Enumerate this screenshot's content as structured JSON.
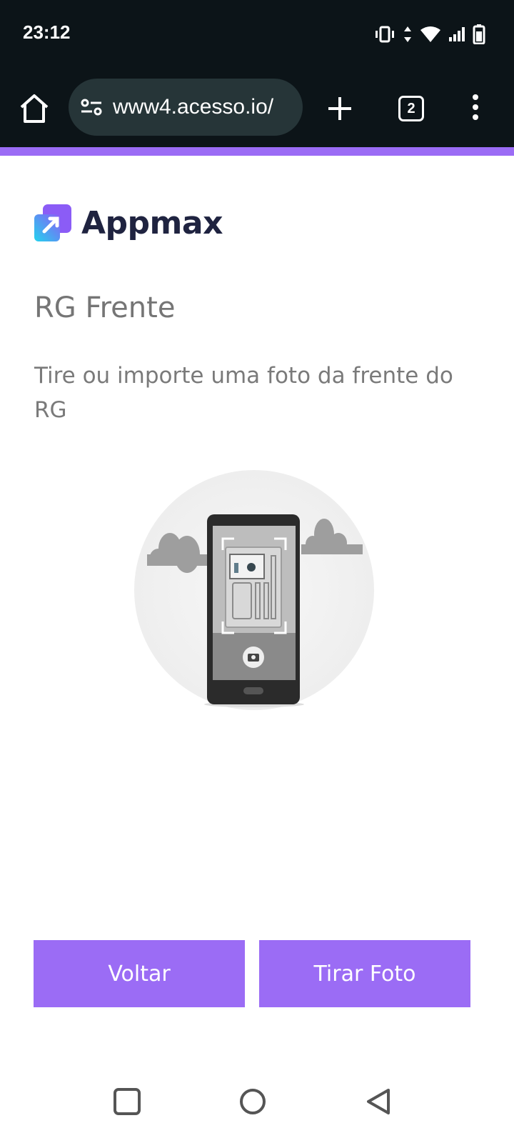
{
  "status_bar": {
    "time": "23:12",
    "icons": [
      "vibrate-icon",
      "data-arrows-icon",
      "wifi-icon",
      "signal-icon",
      "battery-icon"
    ]
  },
  "browser": {
    "url": "www4.acesso.io/",
    "tab_count": "2",
    "icons": [
      "home-icon",
      "site-settings-icon",
      "new-tab-icon",
      "tab-switcher-icon",
      "more-vert-icon"
    ]
  },
  "logo": {
    "text": "Appmax"
  },
  "page": {
    "title": "RG Frente",
    "subtitle": "Tire ou importe uma foto da frente do RG"
  },
  "illustration": {
    "name": "phone-camera-id-illustration"
  },
  "buttons": {
    "back_label": "Voltar",
    "take_photo_label": "Tirar Foto"
  },
  "nav": {
    "icons": [
      "recents-icon",
      "home-circle-icon",
      "back-triangle-icon"
    ]
  },
  "colors": {
    "accent": "#9b6cf5",
    "status_bar": "#0c1418",
    "url_pill": "#263538",
    "logo_text": "#1f2340",
    "logo_gradient_top": "#8b5cf6",
    "logo_gradient_bottom": "#22d3ee"
  }
}
